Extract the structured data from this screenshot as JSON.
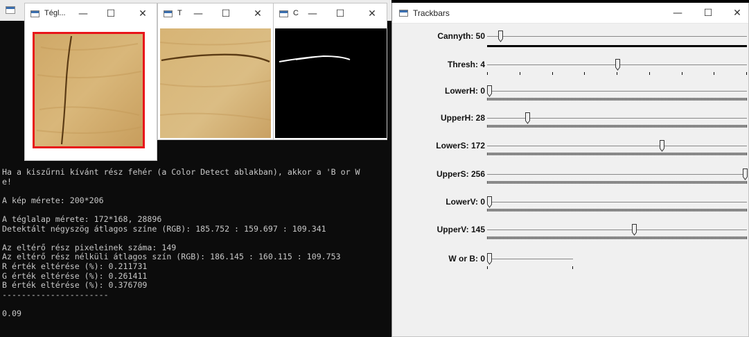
{
  "console": {
    "lines": [
      "Ha a kiszűrni kívánt rész fehér (a Color Detect ablakban), akkor a 'B or W",
      "e!",
      "",
      "A kép mérete: 200*206",
      "",
      "A téglalap mérete: 172*168, 28896",
      "Detektált négyszög átlagos színe (RGB): 185.752 : 159.697 : 109.341",
      "",
      "Az eltérő rész pixeleinek száma: 149",
      "Az eltérő rész nélküli átlagos szín (RGB): 186.145 : 160.115 : 109.753",
      "R érték eltérése (%): 0.211731",
      "G érték eltérése (%): 0.261411",
      "B érték eltérése (%): 0.376709",
      "----------------------",
      "",
      "0.09"
    ]
  },
  "windows": {
    "w1": {
      "title": "Tégl..."
    },
    "w2": {
      "title": "T"
    },
    "w3": {
      "title": "C"
    }
  },
  "titlebar_buttons": {
    "minimize": "—",
    "maximize": "☐",
    "close": "✕"
  },
  "trackbars": {
    "title": "Trackbars",
    "items": [
      {
        "label": "Cannyth: 50",
        "value": 50,
        "max": 1000,
        "ticks": "solid"
      },
      {
        "label": "Thresh: 4",
        "value": 4,
        "max": 8,
        "ticks": "sparse"
      },
      {
        "label": "LowerH: 0",
        "value": 0,
        "max": 180,
        "ticks": "dense"
      },
      {
        "label": "UpperH: 28",
        "value": 28,
        "max": 180,
        "ticks": "dense"
      },
      {
        "label": "LowerS: 172",
        "value": 172,
        "max": 256,
        "ticks": "dense"
      },
      {
        "label": "UpperS: 256",
        "value": 256,
        "max": 256,
        "ticks": "dense"
      },
      {
        "label": "LowerV: 0",
        "value": 0,
        "max": 256,
        "ticks": "dense"
      },
      {
        "label": "UpperV: 145",
        "value": 145,
        "max": 256,
        "ticks": "dense"
      },
      {
        "label": "W or B: 0",
        "value": 0,
        "max": 1,
        "ticks": "short"
      }
    ]
  },
  "colors": {
    "selection_frame": "#e8141a",
    "console_bg": "#0c0c0c",
    "console_text": "#c8c8c8",
    "trackbar_bg": "#f0f0f0"
  }
}
